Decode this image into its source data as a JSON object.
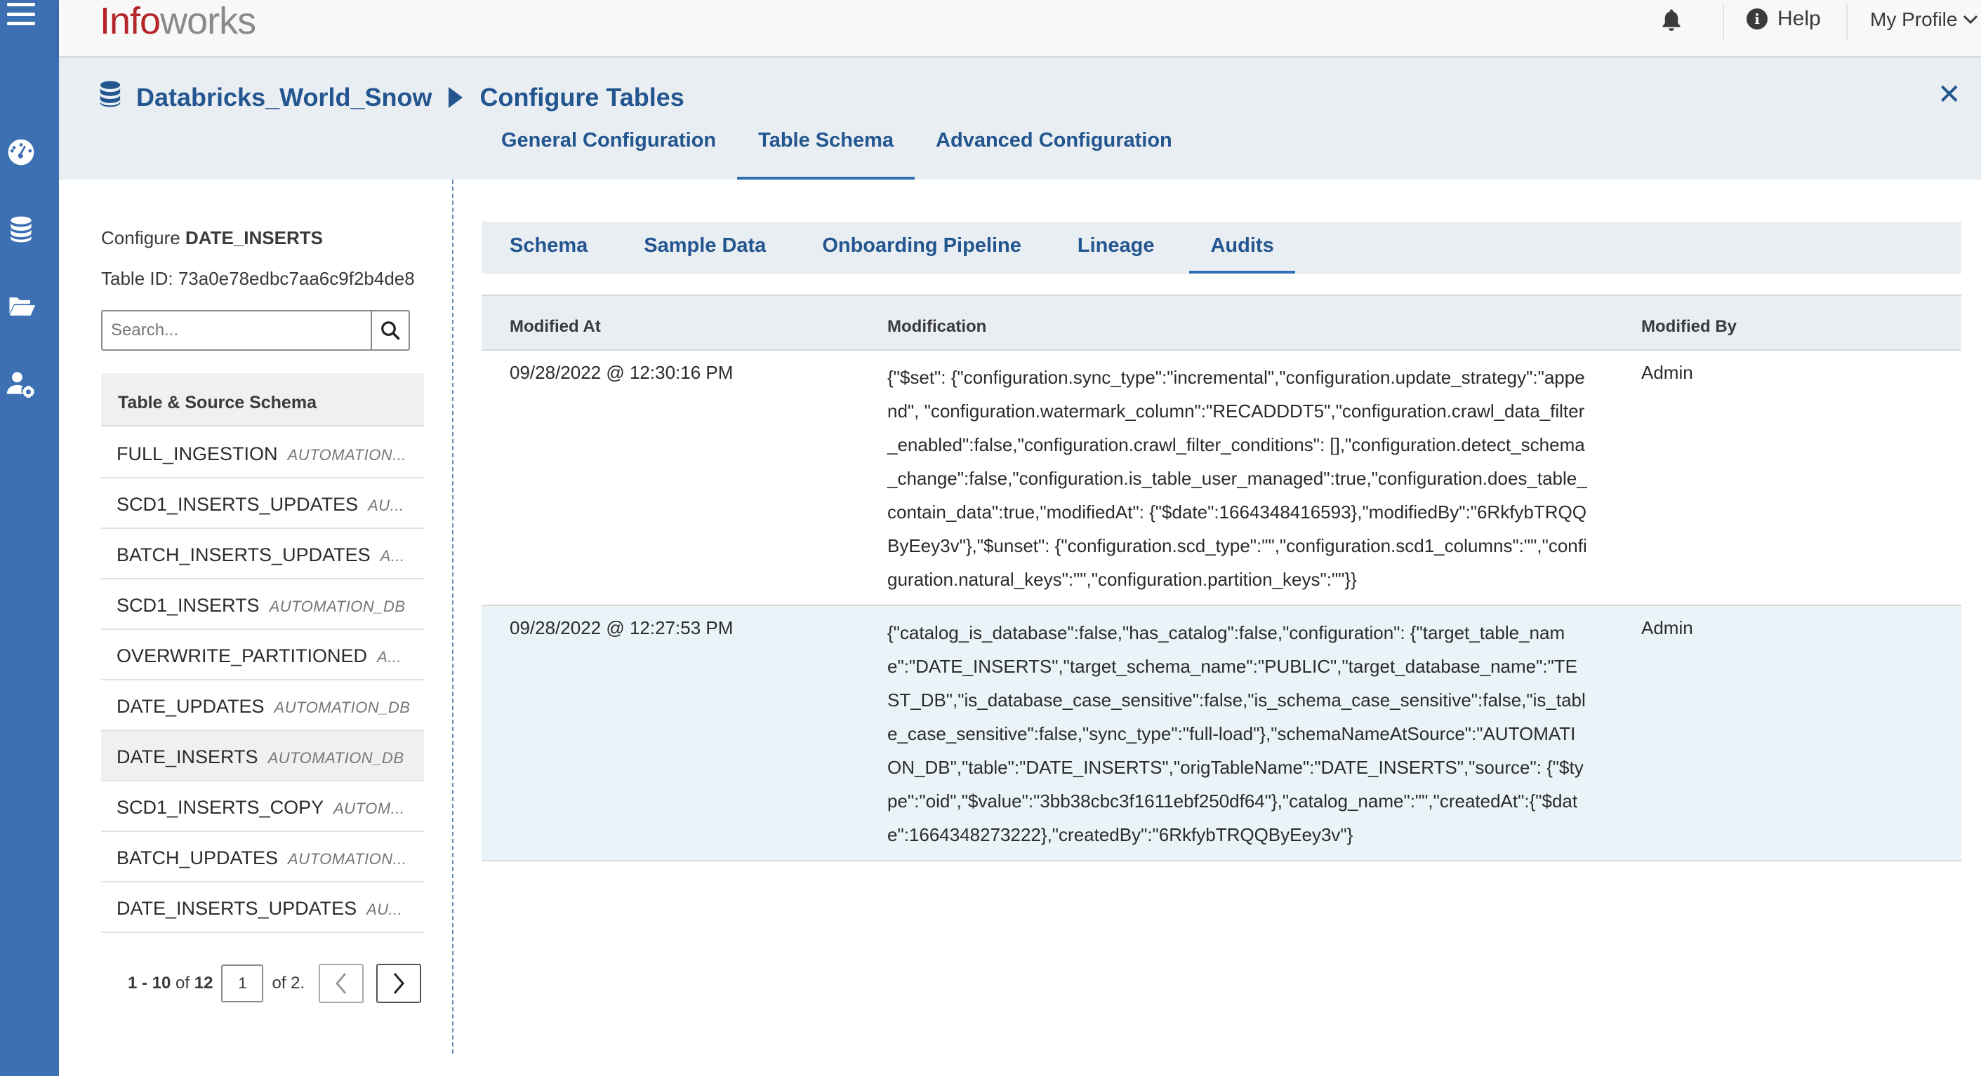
{
  "header": {
    "logo_part1": "Info",
    "logo_part2": "works",
    "help_label": "Help",
    "profile_label": "My Profile"
  },
  "breadcrumb": {
    "source": "Databricks_World_Snow",
    "page": "Configure Tables"
  },
  "main_tabs": [
    {
      "label": "General Configuration",
      "active": false
    },
    {
      "label": "Table Schema",
      "active": true
    },
    {
      "label": "Advanced Configuration",
      "active": false
    }
  ],
  "left_panel": {
    "configure_prefix": "Configure",
    "table_name": "DATE_INSERTS",
    "table_id": "Table ID: 73a0e78edbc7aa6c9f2b4de8",
    "search_placeholder": "Search...",
    "list_header": "Table & Source Schema",
    "items": [
      {
        "name": "FULL_INGESTION",
        "schema": "AUTOMATION..."
      },
      {
        "name": "SCD1_INSERTS_UPDATES",
        "schema": "AU..."
      },
      {
        "name": "BATCH_INSERTS_UPDATES",
        "schema": "A..."
      },
      {
        "name": "SCD1_INSERTS",
        "schema": "AUTOMATION_DB"
      },
      {
        "name": "OVERWRITE_PARTITIONED",
        "schema": "A..."
      },
      {
        "name": "DATE_UPDATES",
        "schema": "AUTOMATION_DB"
      },
      {
        "name": "DATE_INSERTS",
        "schema": "AUTOMATION_DB"
      },
      {
        "name": "SCD1_INSERTS_COPY",
        "schema": "AUTOM..."
      },
      {
        "name": "BATCH_UPDATES",
        "schema": "AUTOMATION..."
      },
      {
        "name": "DATE_INSERTS_UPDATES",
        "schema": "AU..."
      }
    ],
    "pager": {
      "range": "1 - 10",
      "of_label": "of",
      "total": "12",
      "page": "1",
      "pages_label": "of 2."
    }
  },
  "sub_tabs": [
    {
      "label": "Schema",
      "active": false
    },
    {
      "label": "Sample Data",
      "active": false
    },
    {
      "label": "Onboarding Pipeline",
      "active": false
    },
    {
      "label": "Lineage",
      "active": false
    },
    {
      "label": "Audits",
      "active": true
    }
  ],
  "audits": {
    "columns": [
      "Modified At",
      "Modification",
      "Modified By"
    ],
    "rows": [
      {
        "modified_at": "09/28/2022 @ 12:30:16 PM",
        "modification": "{\"$set\": {\"configuration.sync_type\":\"incremental\",\"configuration.update_strategy\":\"append\", \"configuration.watermark_column\":\"RECADDDT5\",\"configuration.crawl_data_filter_enabled\":false,\"configuration.crawl_filter_conditions\": [],\"configuration.detect_schema_change\":false,\"configuration.is_table_user_managed\":true,\"configuration.does_table_contain_data\":true,\"modifiedAt\": {\"$date\":1664348416593},\"modifiedBy\":\"6RkfybTRQQByEey3v\"},\"$unset\": {\"configuration.scd_type\":\"\",\"configuration.scd1_columns\":\"\",\"configuration.natural_keys\":\"\",\"configuration.partition_keys\":\"\"}}",
        "modified_by": "Admin"
      },
      {
        "modified_at": "09/28/2022 @ 12:27:53 PM",
        "modification": "{\"catalog_is_database\":false,\"has_catalog\":false,\"configuration\": {\"target_table_name\":\"DATE_INSERTS\",\"target_schema_name\":\"PUBLIC\",\"target_database_name\":\"TEST_DB\",\"is_database_case_sensitive\":false,\"is_schema_case_sensitive\":false,\"is_table_case_sensitive\":false,\"sync_type\":\"full-load\"},\"schemaNameAtSource\":\"AUTOMATION_DB\",\"table\":\"DATE_INSERTS\",\"origTableName\":\"DATE_INSERTS\",\"source\": {\"$type\":\"oid\",\"$value\":\"3bb38cbc3f1611ebf250df64\"},\"catalog_name\":\"\",\"createdAt\":{\"$date\":1664348273222},\"createdBy\":\"6RkfybTRQQByEey3v\"}",
        "modified_by": "Admin"
      }
    ]
  }
}
